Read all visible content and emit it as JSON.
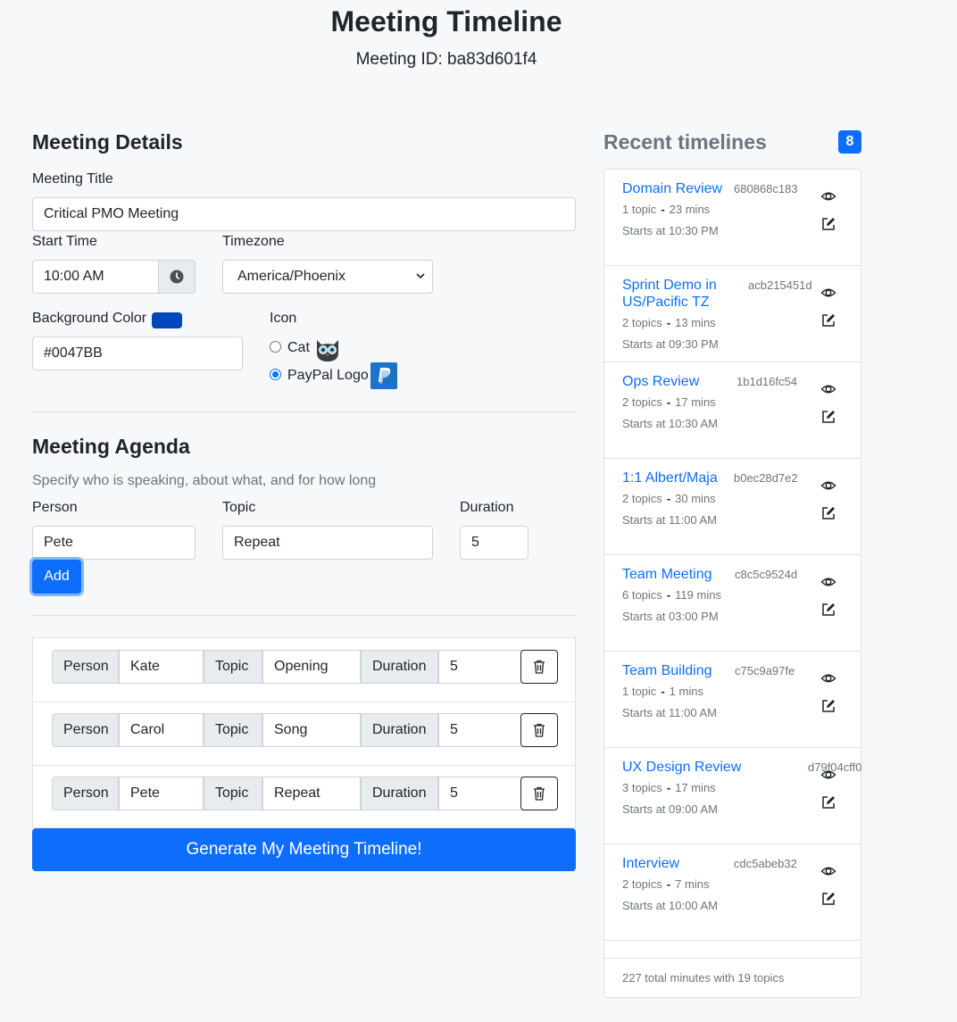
{
  "header": {
    "title": "Meeting Timeline",
    "meeting_id": "Meeting ID: ba83d601f4"
  },
  "details": {
    "section_title": "Meeting Details",
    "title_label": "Meeting Title",
    "title_value": "Critical PMO Meeting",
    "start_label": "Start Time",
    "start_value": "10:00 AM",
    "timezone_label": "Timezone",
    "timezone_value": "America/Phoenix",
    "bg_label": "Background Color",
    "bg_value": "#0047BB",
    "bg_color": "#0047BB",
    "icon_label": "Icon",
    "icon_options": [
      {
        "label": "Cat",
        "selected": false,
        "icon": "cat-icon"
      },
      {
        "label": "PayPal Logo",
        "selected": true,
        "icon": "paypal-logo-icon"
      }
    ]
  },
  "agenda": {
    "section_title": "Meeting Agenda",
    "subtitle": "Specify who is speaking, about what, and for how long",
    "person_label": "Person",
    "topic_label": "Topic",
    "duration_label": "Duration",
    "person_value": "Pete",
    "topic_value": "Repeat",
    "duration_value": "5",
    "add_label": "Add",
    "rows": [
      {
        "person_label": "Person",
        "person": "Kate",
        "topic_label": "Topic",
        "topic": "Opening",
        "duration_label": "Duration",
        "duration": "5"
      },
      {
        "person_label": "Person",
        "person": "Carol",
        "topic_label": "Topic",
        "topic": "Song",
        "duration_label": "Duration",
        "duration": "5"
      },
      {
        "person_label": "Person",
        "person": "Pete",
        "topic_label": "Topic",
        "topic": "Repeat",
        "duration_label": "Duration",
        "duration": "5"
      }
    ],
    "generate_label": "Generate My Meeting Timeline!"
  },
  "recent": {
    "title": "Recent timelines",
    "count": "8",
    "items": [
      {
        "title": "Domain Review",
        "id": "680868c183",
        "topics": "1 topic",
        "mins": "23 mins",
        "starts": "Starts at 10:30 PM"
      },
      {
        "title": "Sprint Demo in US/Pacific TZ",
        "id": "acb215451d",
        "topics": "2 topics",
        "mins": "13 mins",
        "starts": "Starts at 09:30 PM"
      },
      {
        "title": "Ops Review",
        "id": "1b1d16fc54",
        "topics": "2 topics",
        "mins": "17 mins",
        "starts": "Starts at 10:30 AM"
      },
      {
        "title": "1:1 Albert/Maja",
        "id": "b0ec28d7e2",
        "topics": "2 topics",
        "mins": "30 mins",
        "starts": "Starts at 11:00 AM"
      },
      {
        "title": "Team Meeting",
        "id": "c8c5c9524d",
        "topics": "6 topics",
        "mins": "119 mins",
        "starts": "Starts at 03:00 PM"
      },
      {
        "title": "Team Building",
        "id": "c75c9a97fe",
        "topics": "1 topic",
        "mins": "1 mins",
        "starts": "Starts at 11:00 AM"
      },
      {
        "title": "UX Design Review",
        "id": "d79f04cff0",
        "topics": "3 topics",
        "mins": "17 mins",
        "starts": "Starts at 09:00 AM"
      },
      {
        "title": "Interview",
        "id": "cdc5abeb32",
        "topics": "2 topics",
        "mins": "7 mins",
        "starts": "Starts at 10:00 AM"
      }
    ],
    "footer": "227 total minutes with 19 topics"
  }
}
